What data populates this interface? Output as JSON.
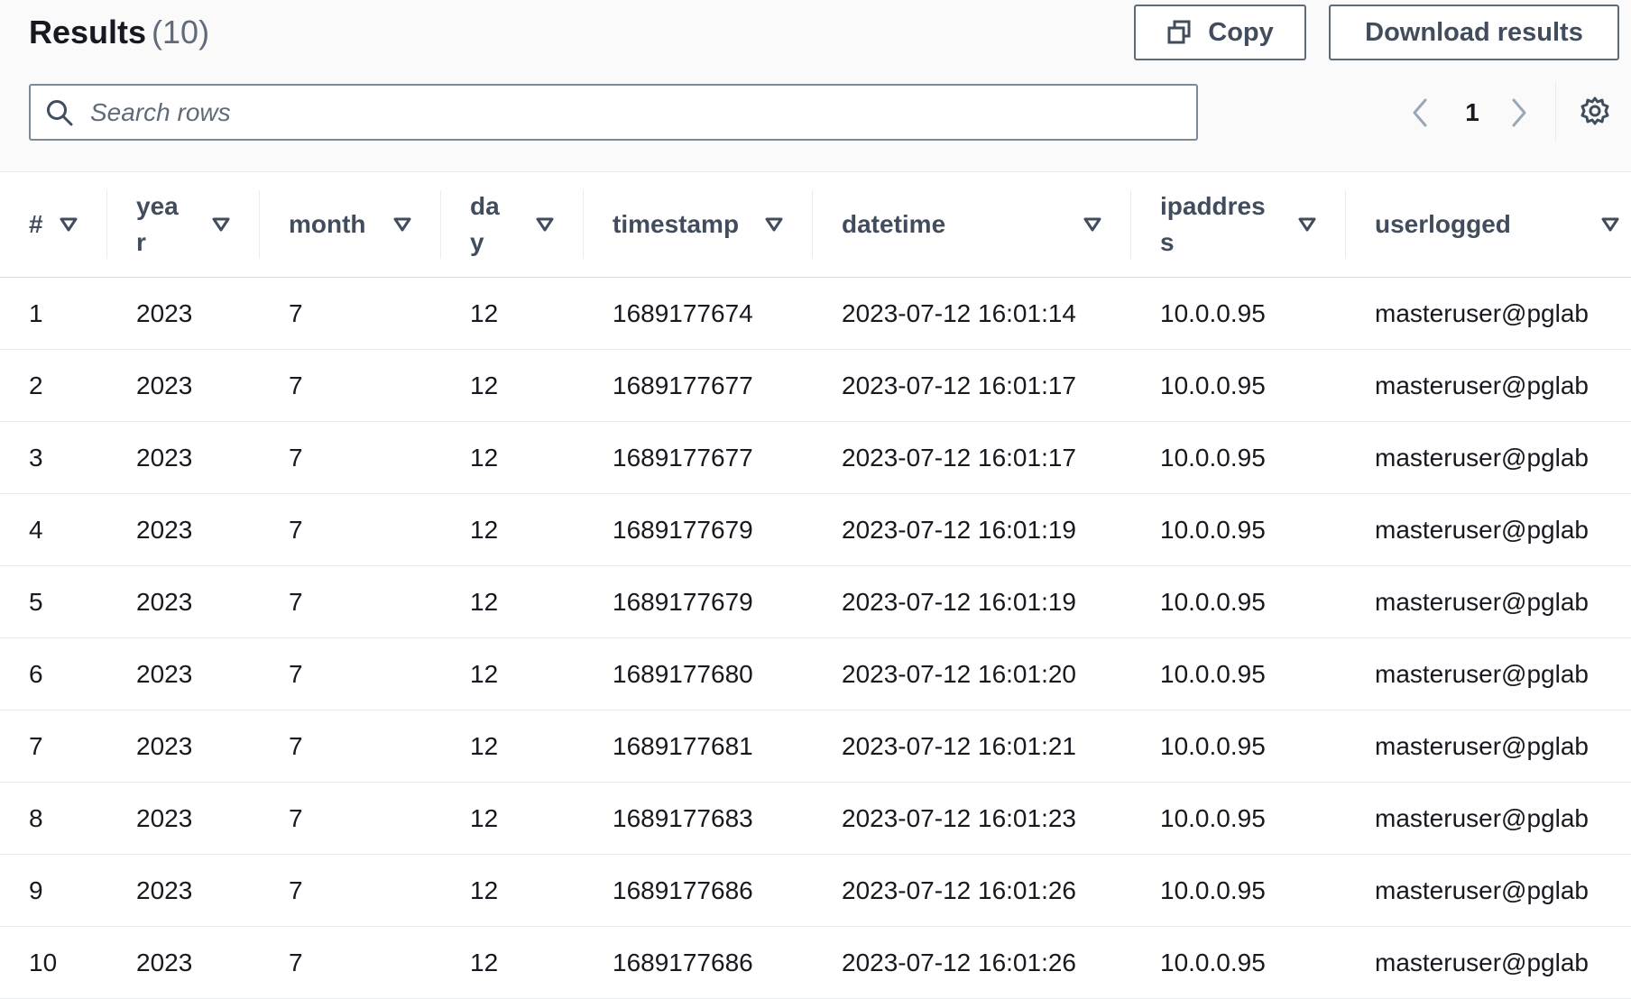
{
  "header": {
    "title": "Results",
    "count": "(10)",
    "copy_label": "Copy",
    "download_label": "Download results"
  },
  "search": {
    "placeholder": "Search rows",
    "value": ""
  },
  "pagination": {
    "current_page": "1"
  },
  "icons": {
    "copy": "copy-icon",
    "search": "search-icon",
    "prev": "chevron-left-icon",
    "next": "chevron-right-icon",
    "settings": "gear-icon",
    "sort": "sort-caret-icon"
  },
  "colors": {
    "header_text": "#414d5c",
    "body_text": "#16191f",
    "border": "#e9ebed"
  },
  "table": {
    "columns": [
      {
        "label": "#"
      },
      {
        "label": "year"
      },
      {
        "label": "month"
      },
      {
        "label": "day"
      },
      {
        "label": "timestamp"
      },
      {
        "label": "datetime"
      },
      {
        "label": "ipaddress"
      },
      {
        "label": "userlogged"
      }
    ],
    "rows": [
      [
        "1",
        "2023",
        "7",
        "12",
        "1689177674",
        "2023-07-12 16:01:14",
        "10.0.0.95",
        "masteruser@pglab"
      ],
      [
        "2",
        "2023",
        "7",
        "12",
        "1689177677",
        "2023-07-12 16:01:17",
        "10.0.0.95",
        "masteruser@pglab"
      ],
      [
        "3",
        "2023",
        "7",
        "12",
        "1689177677",
        "2023-07-12 16:01:17",
        "10.0.0.95",
        "masteruser@pglab"
      ],
      [
        "4",
        "2023",
        "7",
        "12",
        "1689177679",
        "2023-07-12 16:01:19",
        "10.0.0.95",
        "masteruser@pglab"
      ],
      [
        "5",
        "2023",
        "7",
        "12",
        "1689177679",
        "2023-07-12 16:01:19",
        "10.0.0.95",
        "masteruser@pglab"
      ],
      [
        "6",
        "2023",
        "7",
        "12",
        "1689177680",
        "2023-07-12 16:01:20",
        "10.0.0.95",
        "masteruser@pglab"
      ],
      [
        "7",
        "2023",
        "7",
        "12",
        "1689177681",
        "2023-07-12 16:01:21",
        "10.0.0.95",
        "masteruser@pglab"
      ],
      [
        "8",
        "2023",
        "7",
        "12",
        "1689177683",
        "2023-07-12 16:01:23",
        "10.0.0.95",
        "masteruser@pglab"
      ],
      [
        "9",
        "2023",
        "7",
        "12",
        "1689177686",
        "2023-07-12 16:01:26",
        "10.0.0.95",
        "masteruser@pglab"
      ],
      [
        "10",
        "2023",
        "7",
        "12",
        "1689177686",
        "2023-07-12 16:01:26",
        "10.0.0.95",
        "masteruser@pglab"
      ]
    ]
  }
}
